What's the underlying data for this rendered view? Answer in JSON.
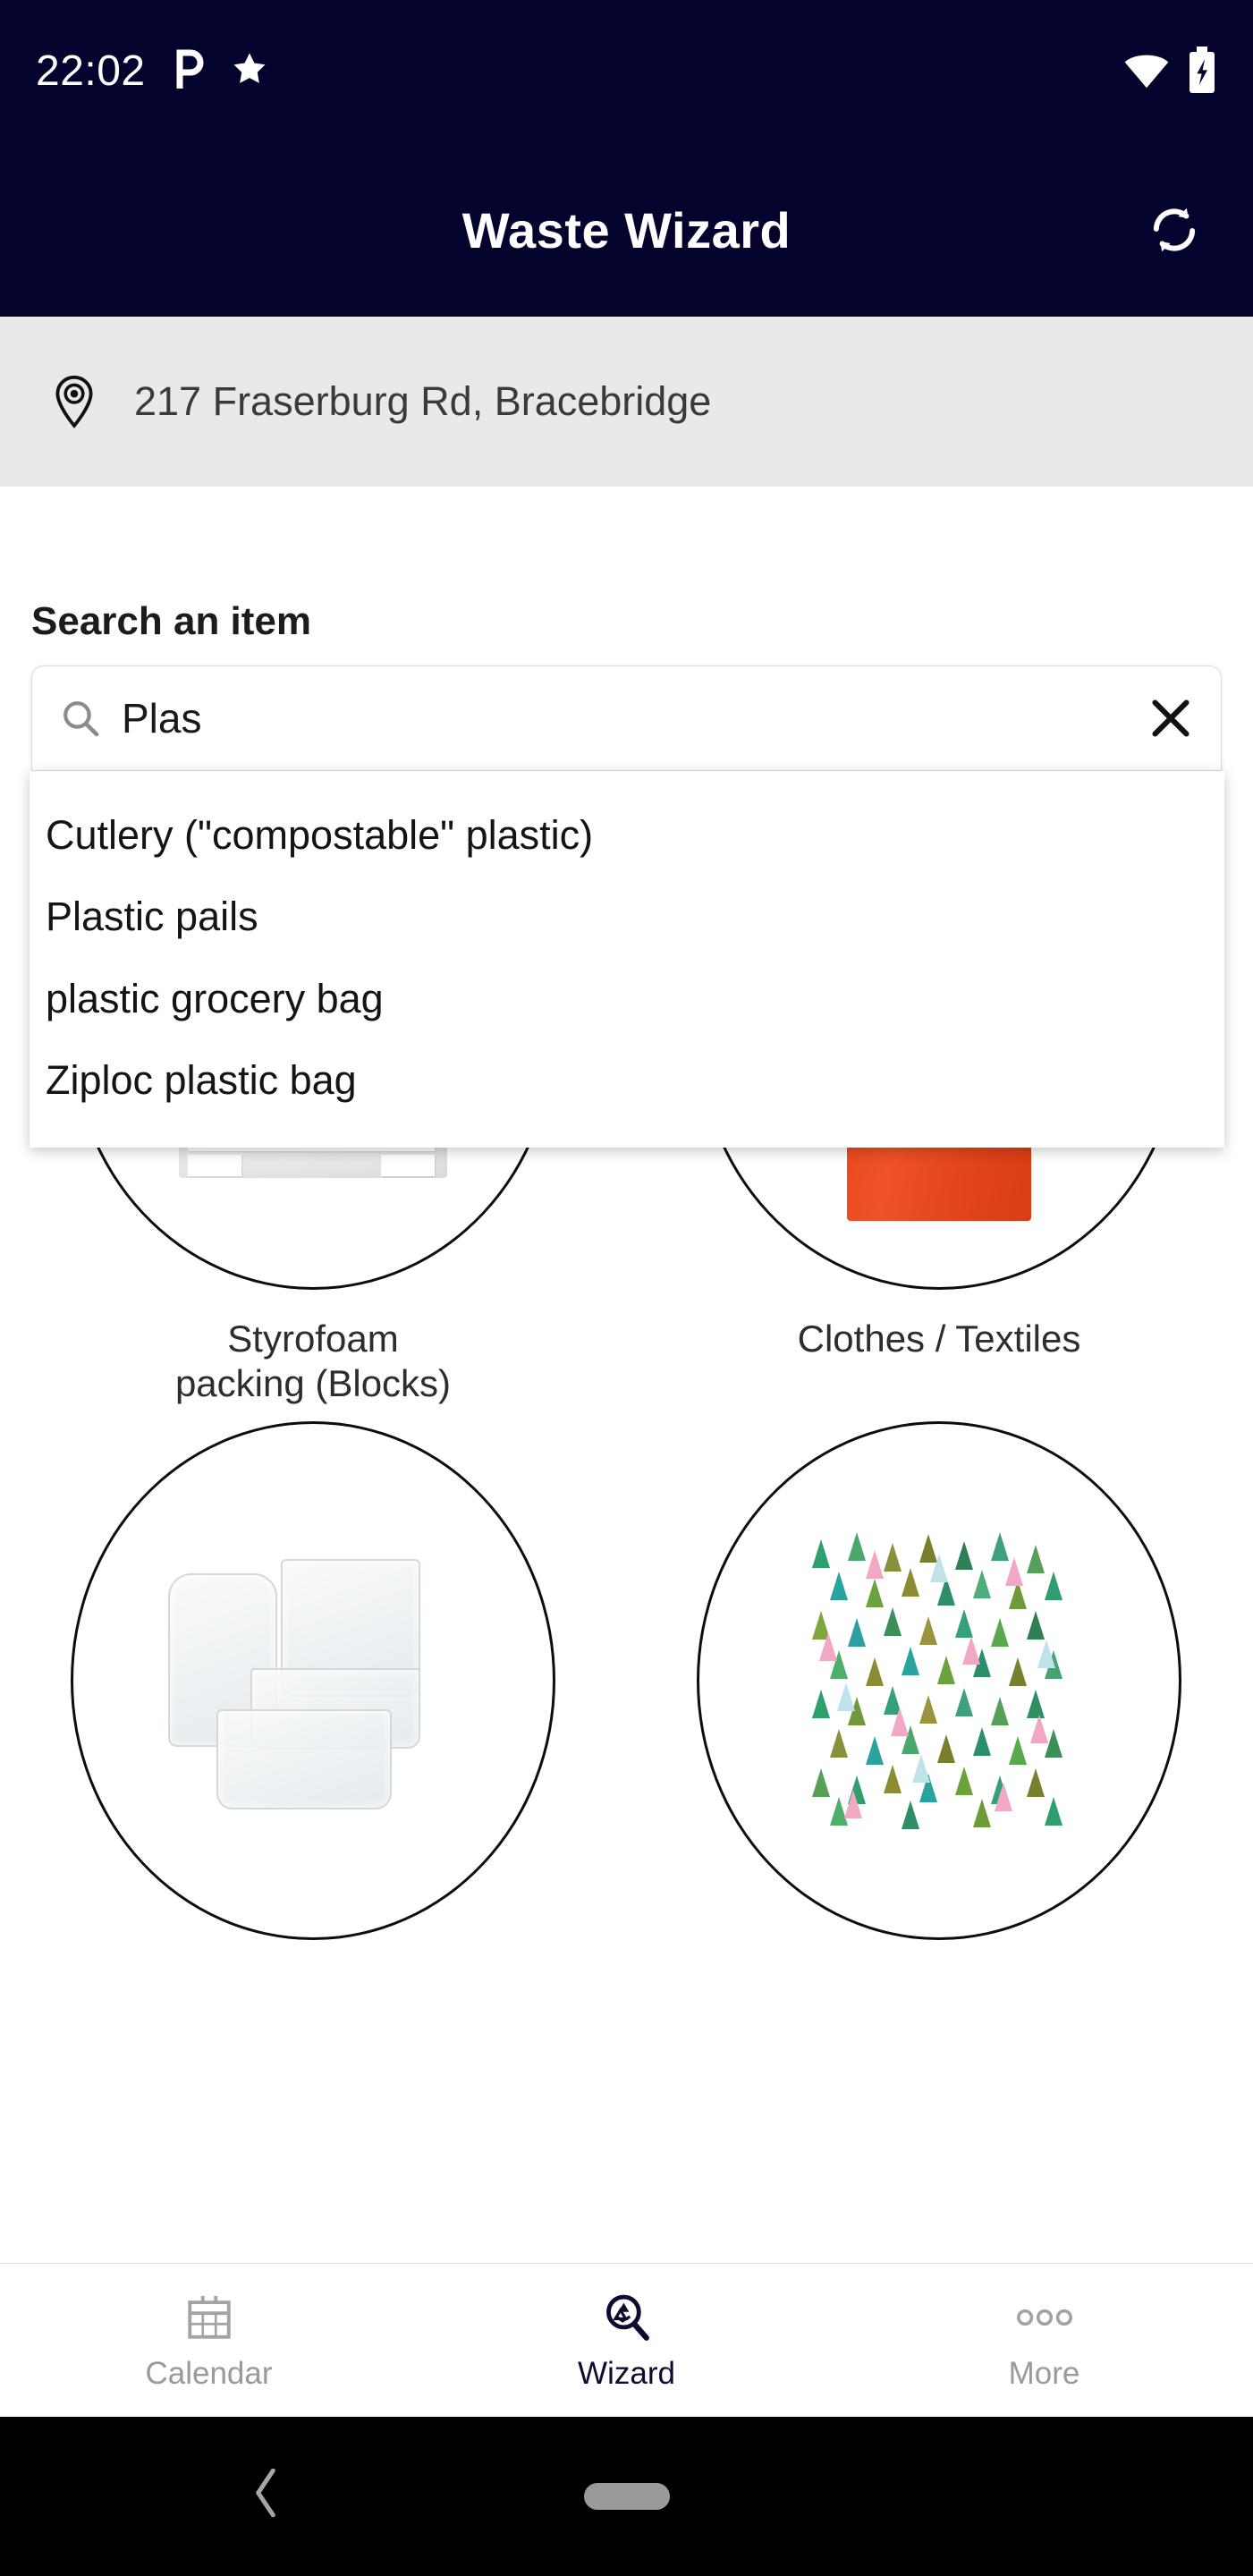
{
  "status_bar": {
    "time": "22:02",
    "icons": [
      "pinterest-p-icon",
      "star-icon",
      "wifi-icon",
      "battery-charging-icon"
    ]
  },
  "header": {
    "title": "Waste Wizard",
    "refresh_icon": "refresh-sync-icon",
    "background_color": "#04032e"
  },
  "address": {
    "pin_icon": "location-pin-icon",
    "text": "217 Fraserburg Rd, Bracebridge",
    "background_color": "#e9e9e9"
  },
  "search": {
    "label": "Search an item",
    "value": "Plas",
    "placeholder": "Search an item",
    "search_icon": "search-icon",
    "clear_icon": "close-x-icon"
  },
  "suggestions": [
    {
      "label": "Cutlery (\"compostable\" plastic)"
    },
    {
      "label": "Plastic pails"
    },
    {
      "label": "plastic grocery bag"
    },
    {
      "label": "Ziploc plastic bag"
    }
  ],
  "items": [
    {
      "label": "Styrofoam\npacking (Blocks)",
      "label_line1": "Styrofoam",
      "label_line2": "packing (Blocks)",
      "image": "styrofoam-block-image"
    },
    {
      "label": "Clothes / Textiles",
      "label_line1": "Clothes / Textiles",
      "label_line2": "",
      "image": "orange-tshirt-image",
      "accent_color": "#e5441a"
    },
    {
      "label": "",
      "label_line1": "",
      "label_line2": "",
      "image": "clear-plastic-containers-image"
    },
    {
      "label": "",
      "label_line1": "",
      "label_line2": "",
      "image": "forest-trees-pattern-image"
    }
  ],
  "tab_bar": {
    "tabs": [
      {
        "label": "Calendar",
        "icon": "calendar-icon",
        "active": false
      },
      {
        "label": "Wizard",
        "icon": "recycle-magnifier-icon",
        "active": true
      },
      {
        "label": "More",
        "icon": "more-dots-icon",
        "active": false
      }
    ]
  },
  "nav_bar": {
    "back_icon": "back-chevron-icon",
    "home_icon": "home-pill-icon"
  }
}
